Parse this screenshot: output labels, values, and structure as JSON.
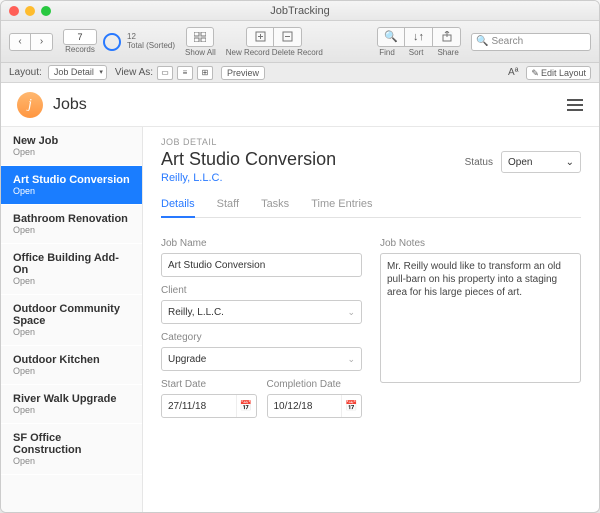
{
  "window": {
    "title": "JobTracking"
  },
  "toolbar": {
    "record_current": "7",
    "record_total": "12",
    "record_status": "Total (Sorted)",
    "records_label": "Records",
    "show_all": "Show All",
    "new_record": "New Record",
    "delete_record": "Delete Record",
    "find": "Find",
    "sort": "Sort",
    "share": "Share",
    "search_placeholder": "Search"
  },
  "layoutbar": {
    "layout_label": "Layout:",
    "layout_value": "Job Detail",
    "viewas_label": "View As:",
    "preview": "Preview",
    "aa": "Aª",
    "edit_layout": "Edit Layout"
  },
  "header": {
    "logo_letter": "j",
    "title": "Jobs"
  },
  "sidebar": {
    "items": [
      {
        "title": "New Job",
        "sub": "Open"
      },
      {
        "title": "Art Studio Conversion",
        "sub": "Open"
      },
      {
        "title": "Bathroom Renovation",
        "sub": "Open"
      },
      {
        "title": "Office Building Add-On",
        "sub": "Open"
      },
      {
        "title": "Outdoor Community Space",
        "sub": "Open"
      },
      {
        "title": "Outdoor Kitchen",
        "sub": "Open"
      },
      {
        "title": "River Walk Upgrade",
        "sub": "Open"
      },
      {
        "title": "SF Office Construction",
        "sub": "Open"
      }
    ],
    "selected_index": 1
  },
  "detail": {
    "crumb": "JOB DETAIL",
    "title": "Art Studio Conversion",
    "client_link": "Reilly, L.L.C.",
    "status_label": "Status",
    "status_value": "Open",
    "tabs": [
      "Details",
      "Staff",
      "Tasks",
      "Time Entries"
    ],
    "active_tab": 0,
    "fields": {
      "job_name_label": "Job Name",
      "job_name_value": "Art Studio Conversion",
      "client_label": "Client",
      "client_value": "Reilly, L.L.C.",
      "category_label": "Category",
      "category_value": "Upgrade",
      "start_date_label": "Start Date",
      "start_date_value": "27/11/18",
      "completion_date_label": "Completion Date",
      "completion_date_value": "10/12/18",
      "notes_label": "Job Notes",
      "notes_value": "Mr. Reilly would like to transform an old pull-barn on his property into a staging area for his large pieces of art."
    }
  }
}
